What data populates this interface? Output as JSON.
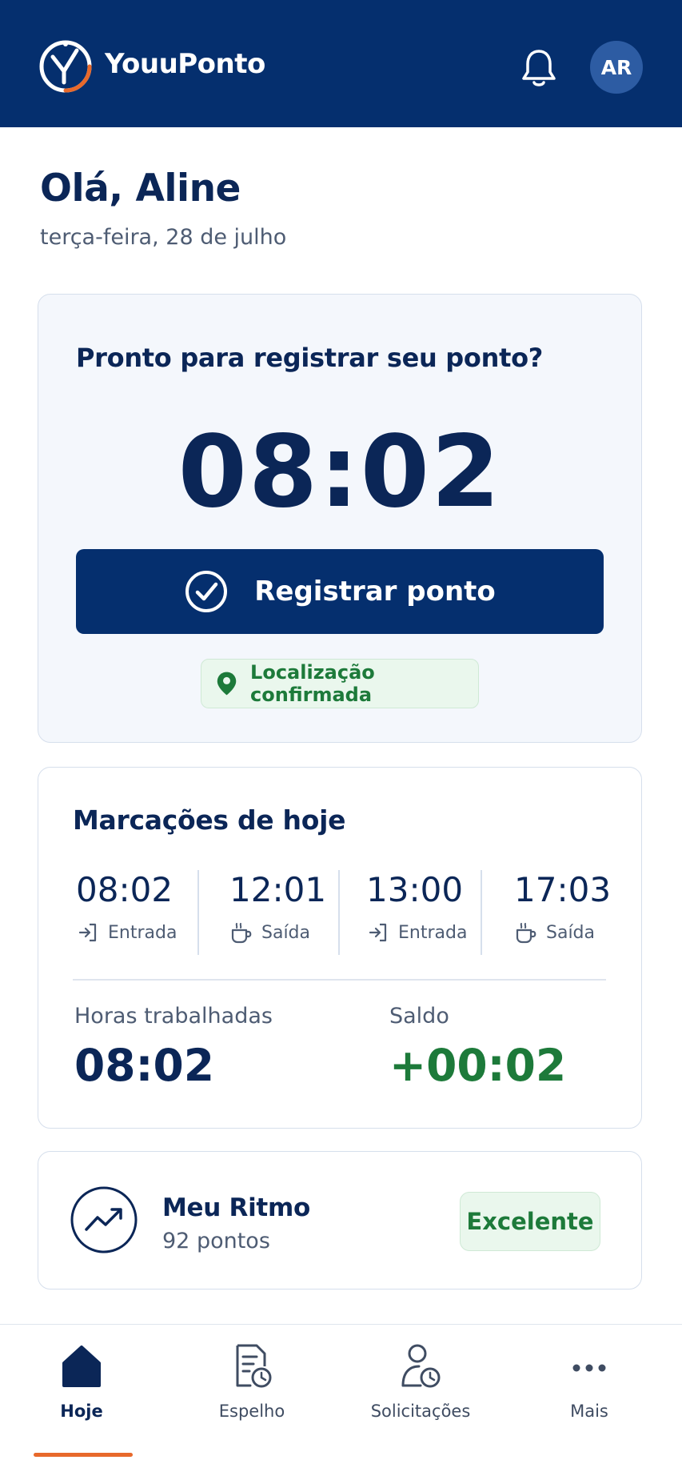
{
  "app": {
    "brand": "YouuPonto",
    "avatar_initials": "AR",
    "colors": {
      "header": "#052f6e",
      "primary": "#052f6e",
      "accent": "#e8692b",
      "success": "#1d7a3a",
      "text_dark": "#0b2657",
      "text_muted": "#4e5c73"
    }
  },
  "header": {
    "logo_icon": "clock-check-logo-icon",
    "notifications_icon": "bell-icon"
  },
  "greeting": {
    "title": "Olá, Aline",
    "date": "terça-feira, 28 de julho"
  },
  "clock_card": {
    "question": "Pronto para registrar seu ponto?",
    "time": "08:02",
    "register_label": "Registrar ponto",
    "register_icon": "check-circle-icon",
    "location_label": "Localização confirmada",
    "location_icon": "map-pin-icon"
  },
  "marks_card": {
    "title": "Marcações de hoje",
    "marks": [
      {
        "time": "08:02",
        "label": "Entrada",
        "icon": "sign-in-icon"
      },
      {
        "time": "12:01",
        "label": "Saída",
        "icon": "coffee-cup-icon"
      },
      {
        "time": "13:00",
        "label": "Entrada",
        "icon": "sign-in-icon"
      },
      {
        "time": "17:03",
        "label": "Saída",
        "icon": "coffee-cup-icon"
      }
    ],
    "worked_label": "Horas trabalhadas",
    "worked_value": "08:02",
    "balance_label": "Saldo",
    "balance_value": "+00:02"
  },
  "ritmo_card": {
    "icon": "trending-up-icon",
    "title": "Meu Ritmo",
    "points": "92 pontos",
    "badge": "Excelente"
  },
  "bottom_nav": {
    "items": [
      {
        "label": "Hoje",
        "icon": "home-icon",
        "active": true
      },
      {
        "label": "Espelho",
        "icon": "document-clock-icon",
        "active": false
      },
      {
        "label": "Solicitações",
        "icon": "user-clock-icon",
        "active": false
      },
      {
        "label": "Mais",
        "icon": "more-dots-icon",
        "active": false
      }
    ]
  }
}
